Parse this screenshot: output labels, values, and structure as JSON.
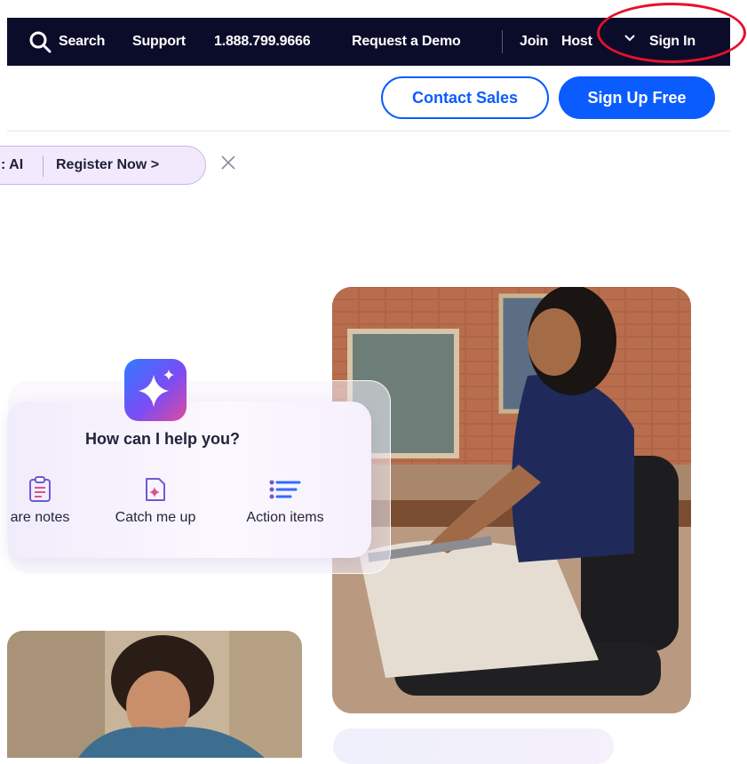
{
  "nav": {
    "search_label": "Search",
    "support": "Support",
    "phone": "1.888.799.9666",
    "request_demo": "Request a Demo",
    "join": "Join",
    "host": "Host",
    "sign_in": "Sign In"
  },
  "cta": {
    "contact_sales": "Contact Sales",
    "sign_up_free": "Sign Up Free"
  },
  "banner": {
    "partial_text": ": AI",
    "register": "Register Now >"
  },
  "assistant": {
    "title": "How can I help you?",
    "options": [
      {
        "label": "are notes",
        "icon": "clipboard-icon"
      },
      {
        "label": "Catch me up",
        "icon": "document-sparkle-icon"
      },
      {
        "label": "Action items",
        "icon": "list-icon"
      }
    ]
  },
  "colors": {
    "nav_bg": "#0b0c2a",
    "brand_blue": "#0b5cff",
    "highlight_circle": "#e8102a"
  }
}
